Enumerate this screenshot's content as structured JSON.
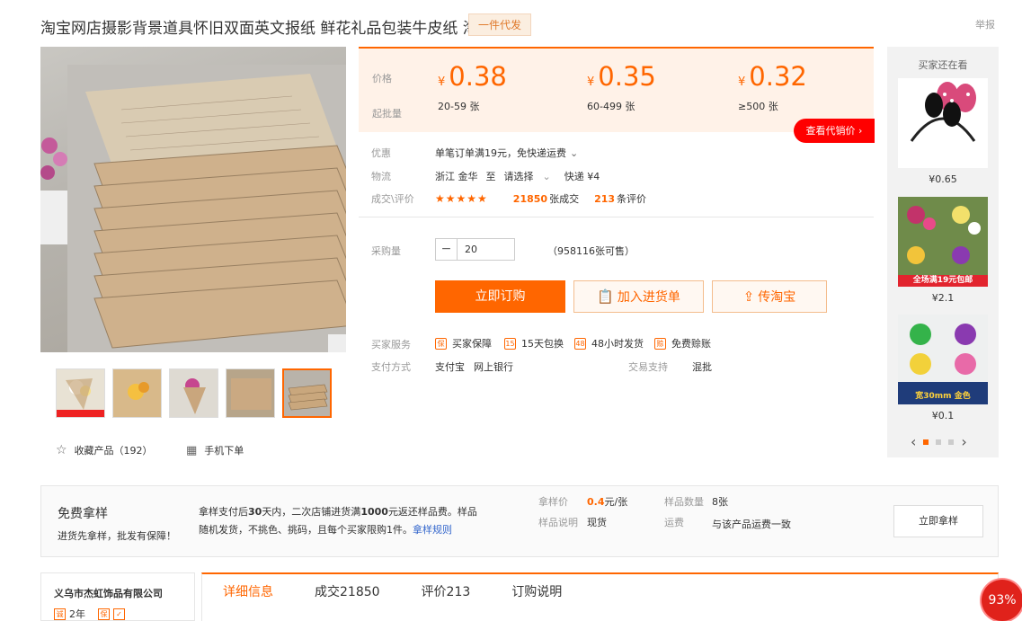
{
  "header": {
    "title": "淘宝网店摄影背景道具怀旧双面英文报纸 鲜花礼品包装牛皮纸 淘",
    "badge": "一件代发",
    "report": "举报"
  },
  "gallery": {
    "zoom_icon": "magnifier-icon",
    "thumb1_banner": "全场满19元包邮"
  },
  "actions": {
    "favorite": "收藏产品（192）",
    "mobile_order": "手机下单"
  },
  "price": {
    "price_label": "价格",
    "moq_label": "起批量",
    "tiers": [
      {
        "currency": "¥",
        "price": "0.38",
        "qty": "20-59 张"
      },
      {
        "currency": "¥",
        "price": "0.35",
        "qty": "60-499 张"
      },
      {
        "currency": "¥",
        "price": "0.32",
        "qty": "≥500 张"
      }
    ],
    "agent_button": "查看代销价 ›"
  },
  "info": {
    "promo_label": "优惠",
    "promo_value": "单笔订单满19元，免快递运费",
    "logistics_label": "物流",
    "logistics_from": "浙江 金华",
    "logistics_to": "至",
    "logistics_select": "请选择",
    "logistics_fee": "快递 ¥4",
    "deal_label": "成交\\评价",
    "stars": "★★★★★",
    "deals_num": "21850",
    "deals_unit": "张成交",
    "reviews_num": "213",
    "reviews_unit": "条评价"
  },
  "purchase": {
    "qty_label": "采购量",
    "qty_value": "20",
    "stock": "（958116张可售）",
    "buy_now": "立即订购",
    "add_cart": "加入进货单",
    "send_taobao": "传淘宝"
  },
  "services": {
    "buyer_label": "买家服务",
    "items": [
      "买家保障",
      "15天包换",
      "48小时发货",
      "免费赊账"
    ],
    "pay_label": "支付方式",
    "pay_methods": [
      "支付宝",
      "网上银行"
    ],
    "trade_label": "交易支持",
    "trade_value": "混批"
  },
  "side": {
    "title": "买家还在看",
    "items": [
      {
        "price": "¥0.65"
      },
      {
        "price": "¥2.1",
        "banner": "全场满19元包邮"
      },
      {
        "price": "¥0.1",
        "banner": "宽30mm 金色"
      }
    ]
  },
  "sample": {
    "title": "免费拿样",
    "subtitle": "进货先拿样，批发有保障！",
    "desc1": "拿样支付后",
    "desc1b": "30",
    "desc2": "天内，二次店铺进货满",
    "desc2b": "1000",
    "desc3": "元返还样品费。样品随机发货，不挑色、挑码，且每个买家限购1件。",
    "rules_link": "拿样规则",
    "price_label": "拿样价",
    "price_value": "0.4",
    "price_unit": "元/张",
    "count_label": "样品数量",
    "count_value": "8张",
    "note_label": "样品说明",
    "note_value": "现货",
    "ship_label": "运费",
    "ship_value": "与该产品运费一致",
    "button": "立即拿样"
  },
  "company": {
    "name": "义乌市杰虹饰品有限公司",
    "years": "2年"
  },
  "tabs": [
    "详细信息",
    "成交21850",
    "评价213",
    "订购说明"
  ],
  "floating": {
    "percent": "93%"
  },
  "colors": {
    "accent": "#ff6600",
    "price_bg": "#fff2e8",
    "red": "#ee0000"
  }
}
